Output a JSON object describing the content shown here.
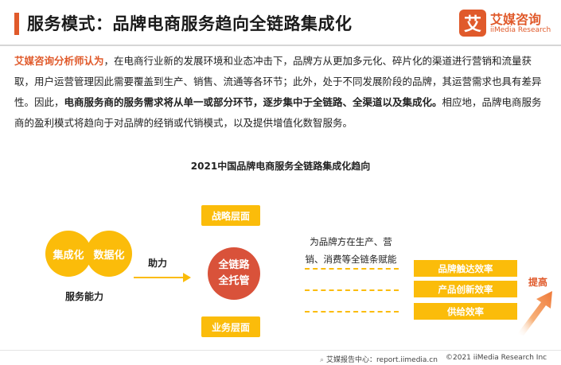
{
  "header": {
    "title": "服务模式：品牌电商服务趋向全链路集成化",
    "logo_mark": "艾",
    "logo_cn": "艾媒咨询",
    "logo_en": "iiMedia Research"
  },
  "paragraph": {
    "lead": "艾媒咨询分析师认为",
    "part1": "，在电商行业新的发展环境和业态冲击下，品牌方从更加多元化、碎片化的渠道进行营销和流量获取，用户运营管理因此需要覆盖到生产、销售、流通等各环节；此外，处于不同发展阶段的品牌，其运营需求也具有差异性。因此，",
    "bold": "电商服务商的服务需求将从单一或部分环节，逐步集中于全链路、全渠道以及集成化。",
    "part2": "相应地，品牌电商服务商的盈利模式将趋向于对品牌的经销或代销模式，以及提供增值化数智服务。"
  },
  "diagram": {
    "title": "2021中国品牌电商服务全链路集成化趋向",
    "circle_left": "集成化",
    "circle_right": "数据化",
    "ability_label": "服务能力",
    "boost_label": "助力",
    "strategy_box": "战略层面",
    "business_box": "业务层面",
    "center_line1": "全链路",
    "center_line2": "全托管",
    "desc_line1": "为品牌方在生产、营",
    "desc_line2": "销、消费等全链条赋能",
    "pills": [
      "品牌触达效率",
      "产品创新效率",
      "供给效率"
    ],
    "improve_label": "提高",
    "accent": "#fbbc0a",
    "center_color": "#d9523a"
  },
  "footer": {
    "left_icon": "search-icon",
    "left_text": "艾媒报告中心：report.iimedia.cn",
    "right_text": "©2021  iiMedia Research  Inc"
  }
}
